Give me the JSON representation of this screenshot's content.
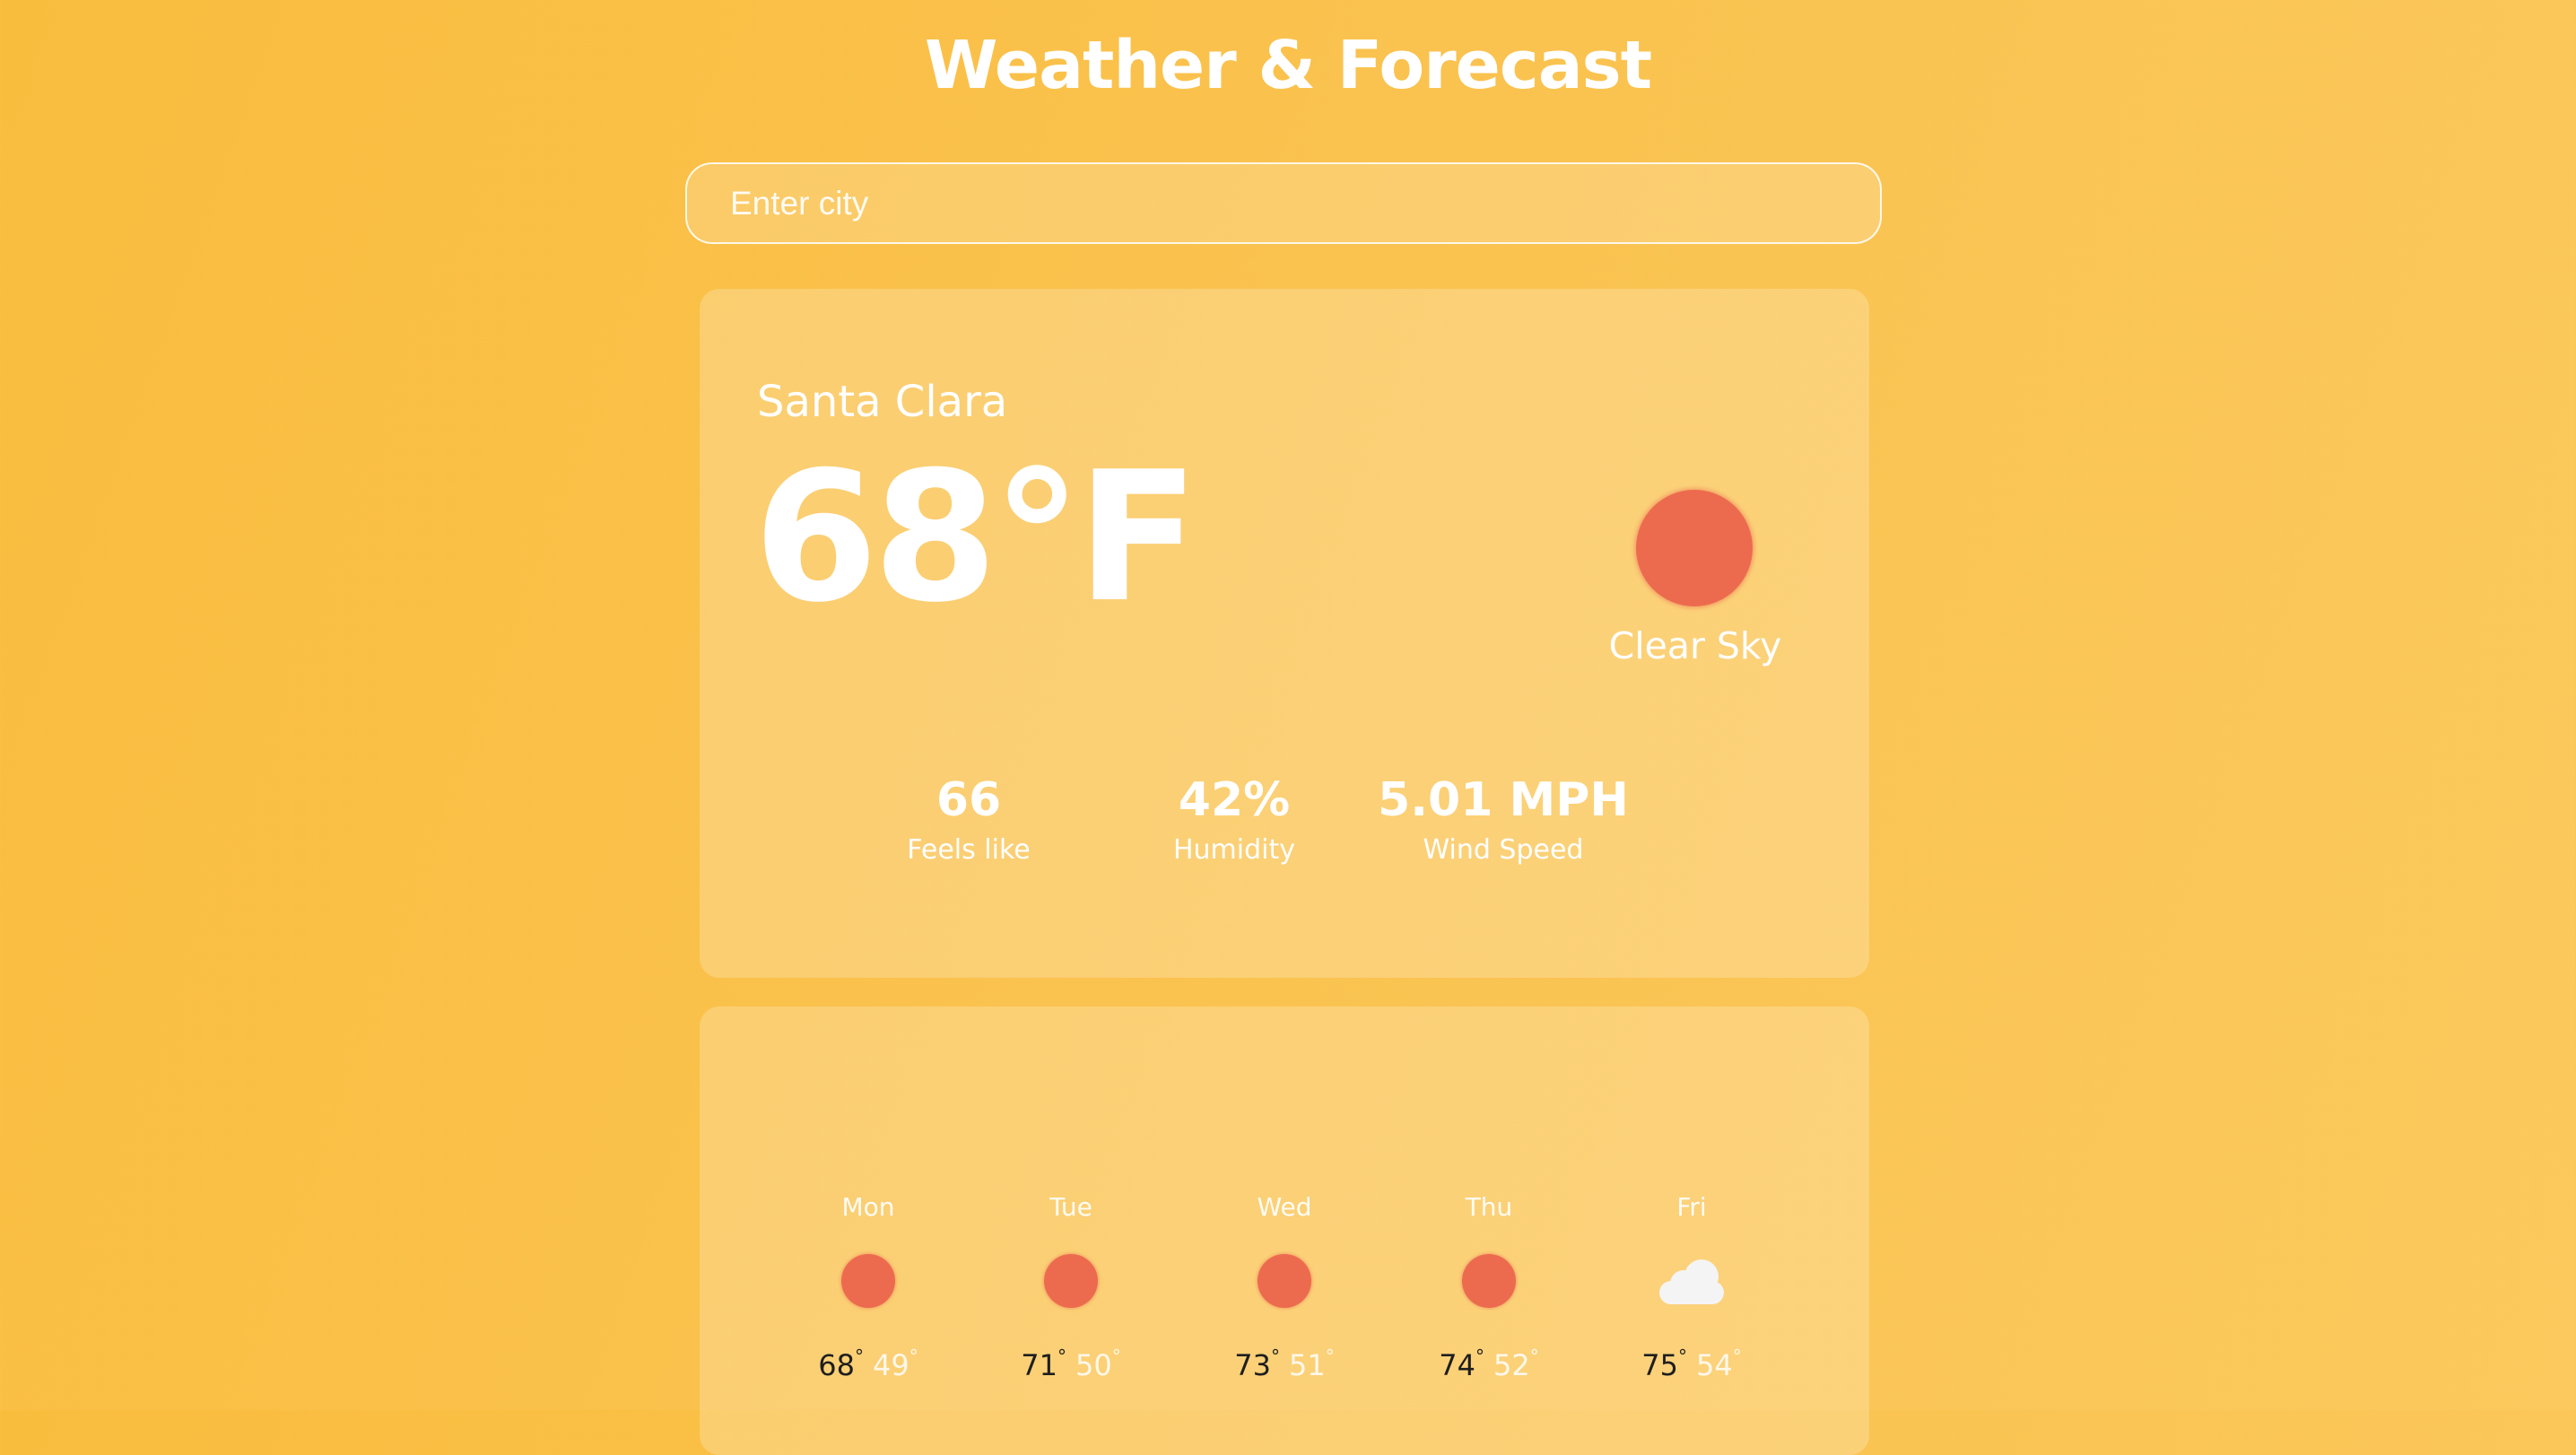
{
  "app": {
    "title": "Weather & Forecast"
  },
  "search": {
    "placeholder": "Enter city",
    "value": ""
  },
  "current": {
    "city": "Santa Clara",
    "temperature": "68°F",
    "condition": "Clear Sky",
    "icon": "sun-icon",
    "stats": {
      "feels_like": {
        "value": "66",
        "label": "Feels like"
      },
      "humidity": {
        "value": "42%",
        "label": "Humidity"
      },
      "wind_speed": {
        "value": "5.01 MPH",
        "label": "Wind Speed"
      }
    }
  },
  "forecast": [
    {
      "day": "Mon",
      "icon": "sun-icon",
      "high": "68",
      "low": "49"
    },
    {
      "day": "Tue",
      "icon": "sun-icon",
      "high": "71",
      "low": "50"
    },
    {
      "day": "Wed",
      "icon": "sun-icon",
      "high": "73",
      "low": "51"
    },
    {
      "day": "Thu",
      "icon": "sun-icon",
      "high": "74",
      "low": "52"
    },
    {
      "day": "Fri",
      "icon": "cloud-icon",
      "high": "75",
      "low": "54"
    }
  ],
  "colors": {
    "background_start": "#f9bd3e",
    "background_end": "#fbc95d",
    "sun": "#ec6b4f",
    "cloud": "#f4f4f4",
    "high_temp_text": "#1e1e1e"
  }
}
